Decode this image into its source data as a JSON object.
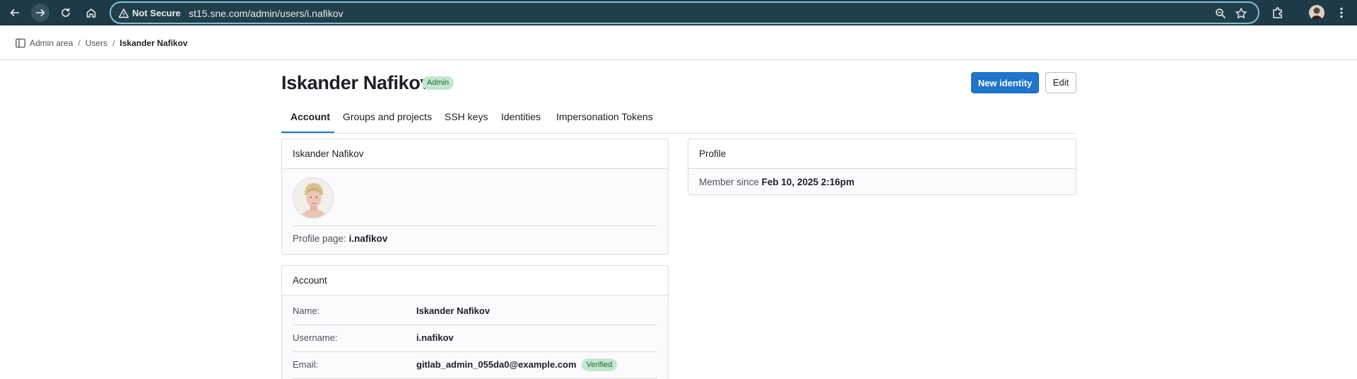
{
  "browser": {
    "security_label": "Not Secure",
    "url": "st15.sne.com/admin/users/i.nafikov"
  },
  "breadcrumb": {
    "items": [
      "Admin area",
      "Users",
      "Iskander Nafikov"
    ]
  },
  "header": {
    "title": "Iskander Nafikov",
    "badge": "Admin",
    "primary_button": "New identity",
    "secondary_button": "Edit"
  },
  "tabs": [
    {
      "label": "Account",
      "active": true
    },
    {
      "label": "Groups and projects",
      "active": false
    },
    {
      "label": "SSH keys",
      "active": false
    },
    {
      "label": "Identities",
      "active": false
    },
    {
      "label": "Impersonation Tokens",
      "active": false
    }
  ],
  "user_card": {
    "title": "Iskander Nafikov",
    "profile_page_label": "Profile page:",
    "profile_page_value": "i.nafikov"
  },
  "profile_card": {
    "title": "Profile",
    "member_since_label": "Member since",
    "member_since_value": "Feb 10, 2025 2:16pm"
  },
  "account_card": {
    "title": "Account",
    "rows": [
      {
        "label": "Name:",
        "value": "Iskander Nafikov"
      },
      {
        "label": "Username:",
        "value": "i.nafikov"
      },
      {
        "label": "Email:",
        "value": "gitlab_admin_055da0@example.com",
        "badge": "Verified"
      }
    ]
  },
  "colors": {
    "chrome_bg": "#1f3a47",
    "accent": "#1f75cb",
    "badge_green_bg": "#c3e6cd",
    "badge_green_text": "#24663b"
  }
}
